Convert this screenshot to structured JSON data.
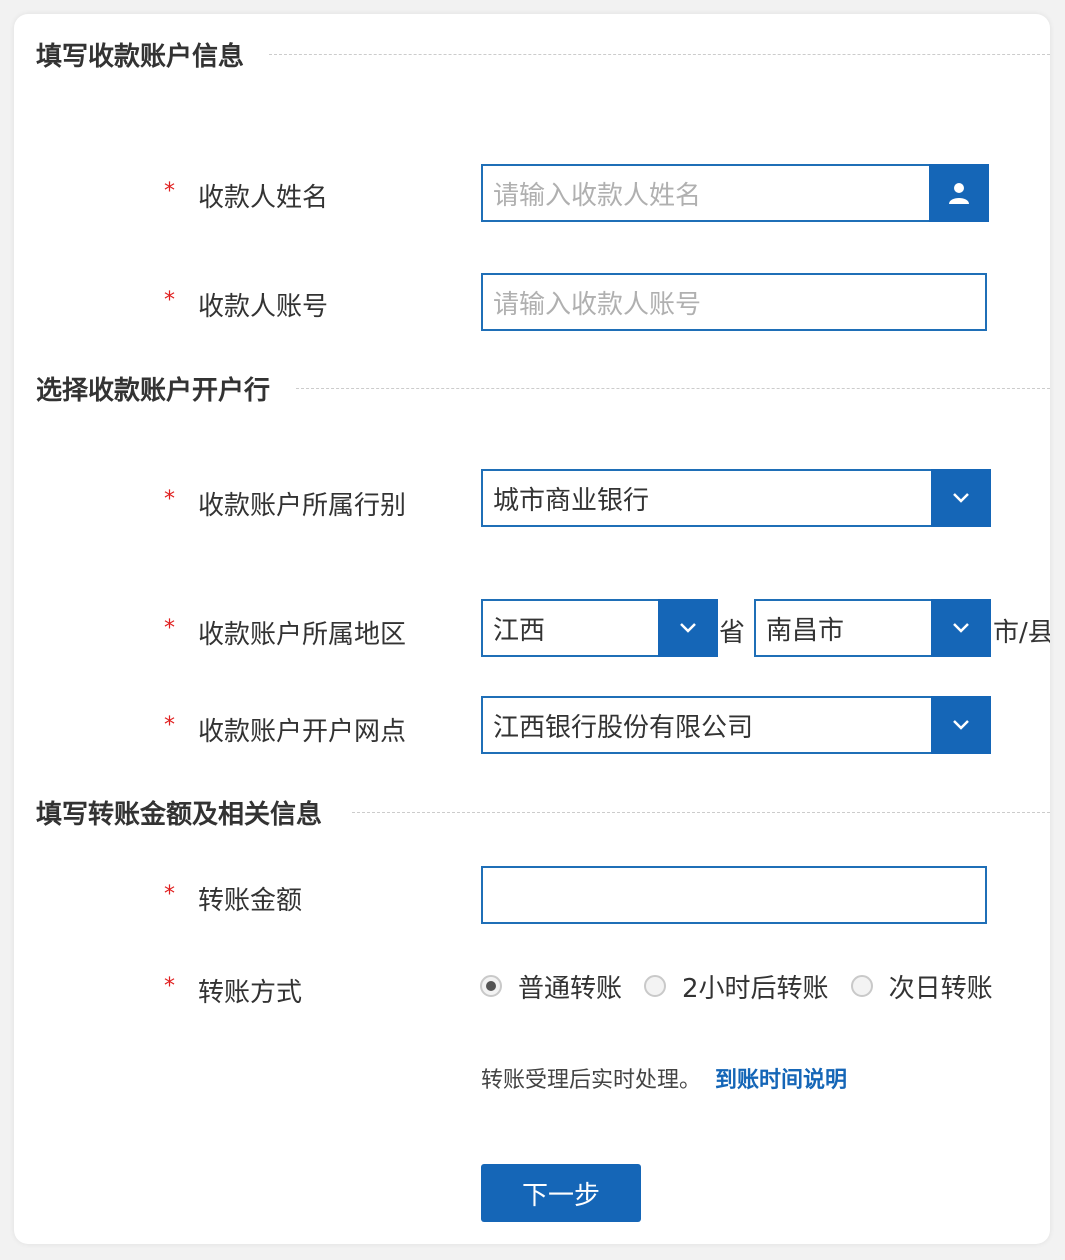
{
  "sections": {
    "payee_info": "填写收款账户信息",
    "bank": "选择收款账户开户行",
    "amount_info": "填写转账金额及相关信息"
  },
  "required_mark": "*",
  "payee_name": {
    "label": "收款人姓名",
    "placeholder": "请输入收款人姓名",
    "icon": "user-icon"
  },
  "payee_account": {
    "label": "收款人账号",
    "placeholder": "请输入收款人账号"
  },
  "bank_type": {
    "label": "收款账户所属行别",
    "value": "城市商业银行",
    "icon": "chevron-down-icon"
  },
  "region": {
    "label": "收款账户所属地区",
    "province": "江西",
    "province_suffix": "省",
    "city": "南昌市",
    "city_suffix": "市/县"
  },
  "branch": {
    "label": "收款账户开户网点",
    "value": "江西银行股份有限公司"
  },
  "amount": {
    "label": "转账金额",
    "value": ""
  },
  "method": {
    "label": "转账方式",
    "options": [
      {
        "label": "普通转账",
        "selected": true
      },
      {
        "label": "2小时后转账",
        "selected": false
      },
      {
        "label": "次日转账",
        "selected": false
      }
    ]
  },
  "note": {
    "text": "转账受理后实时处理。",
    "link": "到账时间说明"
  },
  "next_button": "下一步",
  "colors": {
    "accent": "#1566b7",
    "required": "#e02020"
  }
}
